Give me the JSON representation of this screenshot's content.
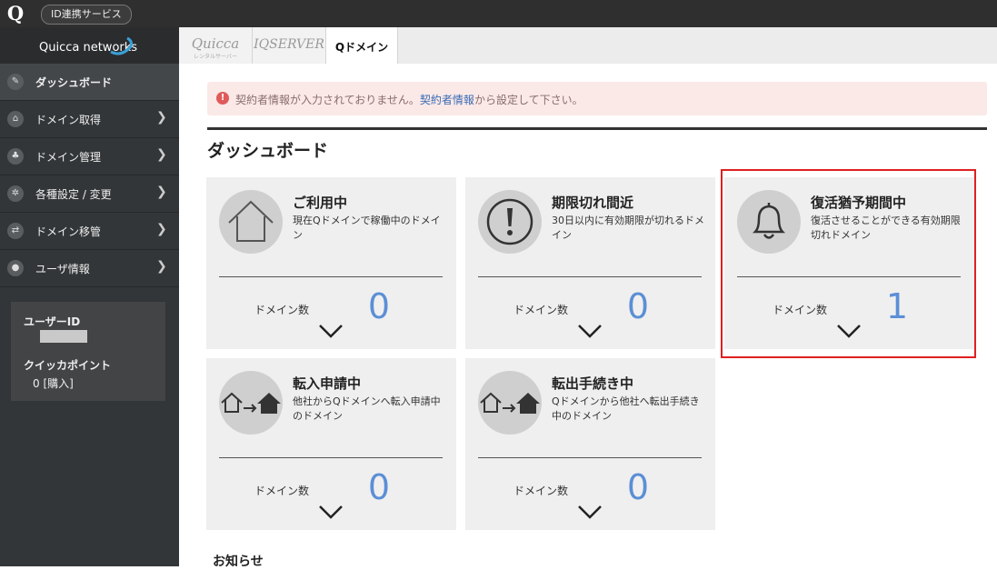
{
  "topbar": {
    "brand": "Q",
    "id_service": "ID連携サービス"
  },
  "sidebar": {
    "logo": "Quicca networks",
    "items": [
      {
        "label": "ダッシュボード",
        "icon": "dashboard-icon",
        "active": true
      },
      {
        "label": "ドメイン取得",
        "icon": "home-icon"
      },
      {
        "label": "ドメイン管理",
        "icon": "bell-icon"
      },
      {
        "label": "各種設定 / 変更",
        "icon": "gear-icon"
      },
      {
        "label": "ドメイン移管",
        "icon": "transfer-icon"
      },
      {
        "label": "ユーザ情報",
        "icon": "user-icon"
      }
    ],
    "user": {
      "id_label": "ユーザーID",
      "points_label": "クイッカポイント",
      "points_value": "0 [購入]"
    }
  },
  "tabs": [
    {
      "label": "Quicca",
      "sub": "レンタルサーバー"
    },
    {
      "label": "IQSERVER"
    },
    {
      "label": "Qドメイン",
      "active": true
    }
  ],
  "alert": {
    "pre": "契約者情報が入力されておりません。",
    "link": "契約者情報",
    "post": "から設定して下さい。"
  },
  "page_title": "ダッシュボード",
  "cards": [
    {
      "title": "ご利用中",
      "desc": "現在Qドメインで稼働中のドメイン",
      "label": "ドメイン数",
      "count": "0"
    },
    {
      "title": "期限切れ間近",
      "desc": "30日以内に有効期限が切れるドメイン",
      "label": "ドメイン数",
      "count": "0"
    },
    {
      "title": "復活猶予期間中",
      "desc": "復活させることができる有効期限切れドメイン",
      "label": "ドメイン数",
      "count": "1"
    },
    {
      "title": "転入申請中",
      "desc": "他社からQドメインへ転入申請中のドメイン",
      "label": "ドメイン数",
      "count": "0"
    },
    {
      "title": "転出手続き中",
      "desc": "Qドメインから他社へ転出手続き中のドメイン",
      "label": "ドメイン数",
      "count": "0"
    }
  ],
  "news_title": "お知らせ",
  "colors": {
    "accent": "#5b8fd6",
    "highlight": "#e02020",
    "alert_bg": "#fbe9e7"
  }
}
